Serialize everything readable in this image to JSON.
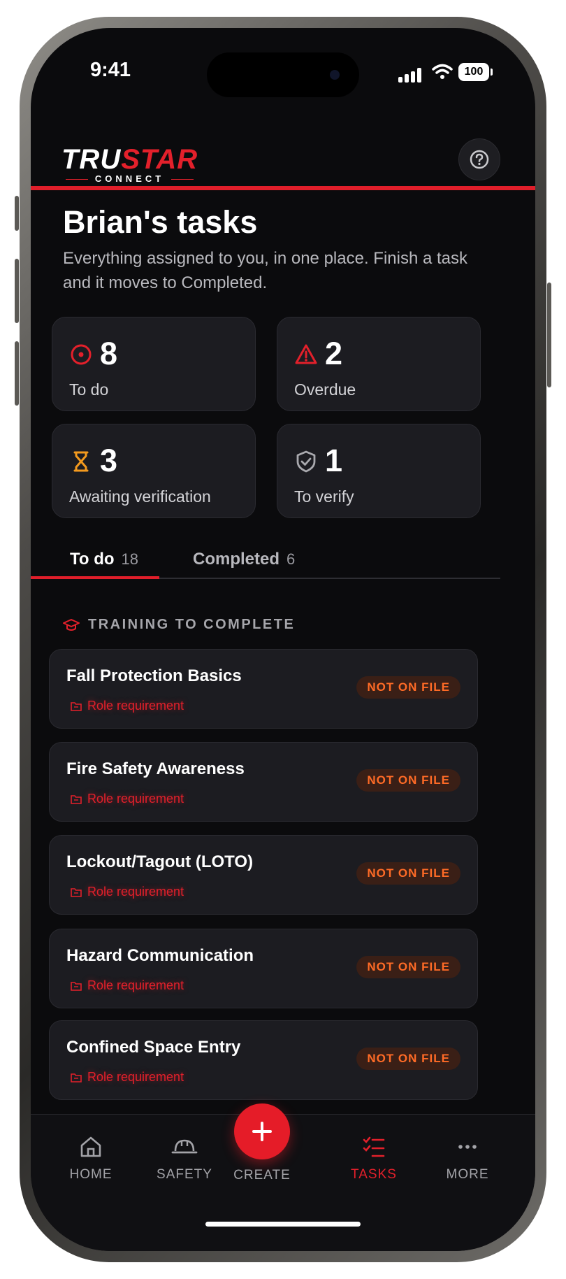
{
  "status_bar": {
    "time": "9:41",
    "battery": "100"
  },
  "header": {
    "logo_primary_a": "TRU",
    "logo_primary_b": "STAR",
    "logo_secondary": "CONNECT",
    "help_icon": "question-circle-icon"
  },
  "page": {
    "title": "Brian's tasks",
    "subtitle": "Everything assigned to you, in one place. Finish a task and it moves to Completed."
  },
  "stats": [
    {
      "value": "8",
      "label": "To do",
      "icon": "target-icon",
      "color": "#e3202b"
    },
    {
      "value": "2",
      "label": "Overdue",
      "icon": "warning-triangle-icon",
      "color": "#e3202b"
    },
    {
      "value": "3",
      "label": "Awaiting verification",
      "icon": "hourglass-icon",
      "color": "#f39a1e"
    },
    {
      "value": "1",
      "label": "To verify",
      "icon": "shield-check-icon",
      "color": "#a9a9ae"
    }
  ],
  "tabs": [
    {
      "label": "To do",
      "count": "18",
      "active": true
    },
    {
      "label": "Completed",
      "count": "6",
      "active": false
    }
  ],
  "section": {
    "title": "TRAINING TO COMPLETE",
    "icon": "graduation-cap-icon"
  },
  "tasks": [
    {
      "title": "Fall Protection Basics",
      "tag": "Role requirement",
      "status": "NOT ON FILE"
    },
    {
      "title": "Fire Safety Awareness",
      "tag": "Role requirement",
      "status": "NOT ON FILE"
    },
    {
      "title": "Lockout/Tagout (LOTO)",
      "tag": "Role requirement",
      "status": "NOT ON FILE"
    },
    {
      "title": "Hazard Communication",
      "tag": "Role requirement",
      "status": "NOT ON FILE"
    },
    {
      "title": "Confined Space Entry",
      "tag": "Role requirement",
      "status": "NOT ON FILE"
    }
  ],
  "nav": [
    {
      "label": "HOME",
      "icon": "home-icon"
    },
    {
      "label": "SAFETY",
      "icon": "hard-hat-icon"
    },
    {
      "label": "CREATE",
      "icon": "plus-icon"
    },
    {
      "label": "TASKS",
      "icon": "checklist-icon",
      "active": true
    },
    {
      "label": "MORE",
      "icon": "more-dots-icon"
    }
  ],
  "colors": {
    "accent": "#e3202b",
    "badge_text": "#ff6b26",
    "background": "#0b0b0d",
    "card": "#1c1c21"
  }
}
